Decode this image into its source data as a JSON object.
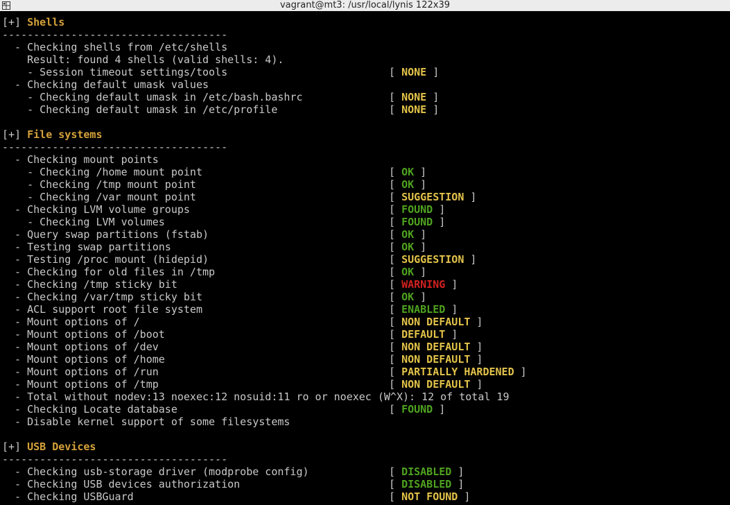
{
  "window": {
    "title": "vagrant@mt3: /usr/local/lynis 122x39",
    "icon": "terminal-menu-icon"
  },
  "colors": {
    "background": "#000000",
    "text": "#c9c9c9",
    "section_title": "#d6a23a",
    "none": "#e3c34a",
    "ok": "#4fa31f",
    "warning": "#d22020"
  },
  "lines": [
    {
      "kind": "section",
      "prefix": "[+] ",
      "title": "Shells"
    },
    {
      "kind": "text",
      "text": "------------------------------------"
    },
    {
      "kind": "text",
      "text": "  - Checking shells from /etc/shells"
    },
    {
      "kind": "text",
      "text": "    Result: found 4 shells (valid shells: 4)."
    },
    {
      "kind": "check",
      "text": "    - Session timeout settings/tools",
      "status": "NONE",
      "color": "yellow"
    },
    {
      "kind": "text",
      "text": "  - Checking default umask values"
    },
    {
      "kind": "check",
      "text": "    - Checking default umask in /etc/bash.bashrc",
      "status": "NONE",
      "color": "yellow"
    },
    {
      "kind": "check",
      "text": "    - Checking default umask in /etc/profile",
      "status": "NONE",
      "color": "yellow"
    },
    {
      "kind": "text",
      "text": ""
    },
    {
      "kind": "section",
      "prefix": "[+] ",
      "title": "File systems"
    },
    {
      "kind": "text",
      "text": "------------------------------------"
    },
    {
      "kind": "text",
      "text": "  - Checking mount points"
    },
    {
      "kind": "check",
      "text": "    - Checking /home mount point",
      "status": "OK",
      "color": "green"
    },
    {
      "kind": "check",
      "text": "    - Checking /tmp mount point",
      "status": "OK",
      "color": "green"
    },
    {
      "kind": "check",
      "text": "    - Checking /var mount point",
      "status": "SUGGESTION",
      "color": "yellow"
    },
    {
      "kind": "check",
      "text": "  - Checking LVM volume groups",
      "status": "FOUND",
      "color": "green"
    },
    {
      "kind": "check",
      "text": "    - Checking LVM volumes",
      "status": "FOUND",
      "color": "green"
    },
    {
      "kind": "check",
      "text": "  - Query swap partitions (fstab)",
      "status": "OK",
      "color": "green"
    },
    {
      "kind": "check",
      "text": "  - Testing swap partitions",
      "status": "OK",
      "color": "green"
    },
    {
      "kind": "check",
      "text": "  - Testing /proc mount (hidepid)",
      "status": "SUGGESTION",
      "color": "yellow"
    },
    {
      "kind": "check",
      "text": "  - Checking for old files in /tmp",
      "status": "OK",
      "color": "green"
    },
    {
      "kind": "check",
      "text": "  - Checking /tmp sticky bit",
      "status": "WARNING",
      "color": "red"
    },
    {
      "kind": "check",
      "text": "  - Checking /var/tmp sticky bit",
      "status": "OK",
      "color": "green"
    },
    {
      "kind": "check",
      "text": "  - ACL support root file system",
      "status": "ENABLED",
      "color": "green"
    },
    {
      "kind": "check",
      "text": "  - Mount options of /",
      "status": "NON DEFAULT",
      "color": "yellow"
    },
    {
      "kind": "check",
      "text": "  - Mount options of /boot",
      "status": "DEFAULT",
      "color": "yellow"
    },
    {
      "kind": "check",
      "text": "  - Mount options of /dev",
      "status": "NON DEFAULT",
      "color": "yellow"
    },
    {
      "kind": "check",
      "text": "  - Mount options of /home",
      "status": "NON DEFAULT",
      "color": "yellow"
    },
    {
      "kind": "check",
      "text": "  - Mount options of /run",
      "status": "PARTIALLY HARDENED",
      "color": "yellow"
    },
    {
      "kind": "check",
      "text": "  - Mount options of /tmp",
      "status": "NON DEFAULT",
      "color": "yellow"
    },
    {
      "kind": "text",
      "text": "  - Total without nodev:13 noexec:12 nosuid:11 ro or noexec (W^X): 12 of total 19"
    },
    {
      "kind": "check",
      "text": "  - Checking Locate database",
      "status": "FOUND",
      "color": "green"
    },
    {
      "kind": "text",
      "text": "  - Disable kernel support of some filesystems"
    },
    {
      "kind": "text",
      "text": ""
    },
    {
      "kind": "section",
      "prefix": "[+] ",
      "title": "USB Devices"
    },
    {
      "kind": "text",
      "text": "------------------------------------"
    },
    {
      "kind": "check",
      "text": "  - Checking usb-storage driver (modprobe config)",
      "status": "DISABLED",
      "color": "green"
    },
    {
      "kind": "check",
      "text": "  - Checking USB devices authorization",
      "status": "DISABLED",
      "color": "green"
    },
    {
      "kind": "check",
      "text": "  - Checking USBGuard",
      "status": "NOT FOUND",
      "color": "yellow"
    }
  ]
}
